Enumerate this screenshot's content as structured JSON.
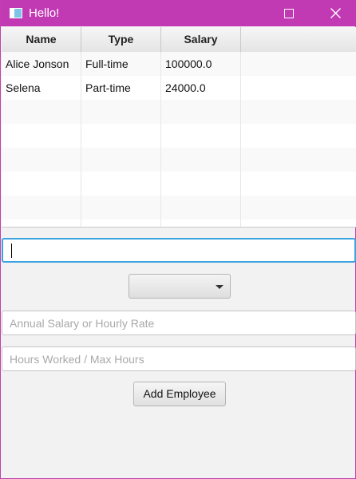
{
  "window": {
    "title": "Hello!"
  },
  "table": {
    "columns": [
      "Name",
      "Type",
      "Salary",
      ""
    ],
    "rows": [
      [
        "Alice Jonson",
        "Full-time",
        "100000.0",
        ""
      ],
      [
        "Selena",
        "Part-time",
        "24000.0",
        ""
      ]
    ]
  },
  "form": {
    "name_value": "",
    "type_selected": "",
    "salary_placeholder": "Annual Salary or Hourly Rate",
    "hours_placeholder": "Hours Worked / Max Hours",
    "add_button": "Add Employee"
  },
  "icons": {
    "app": "window-app-icon",
    "maximize": "maximize-icon",
    "close": "close-icon",
    "combo": "chevron-down-icon"
  },
  "colors": {
    "titlebar": "#c23ab3",
    "focus_border": "#3aa3e0"
  }
}
